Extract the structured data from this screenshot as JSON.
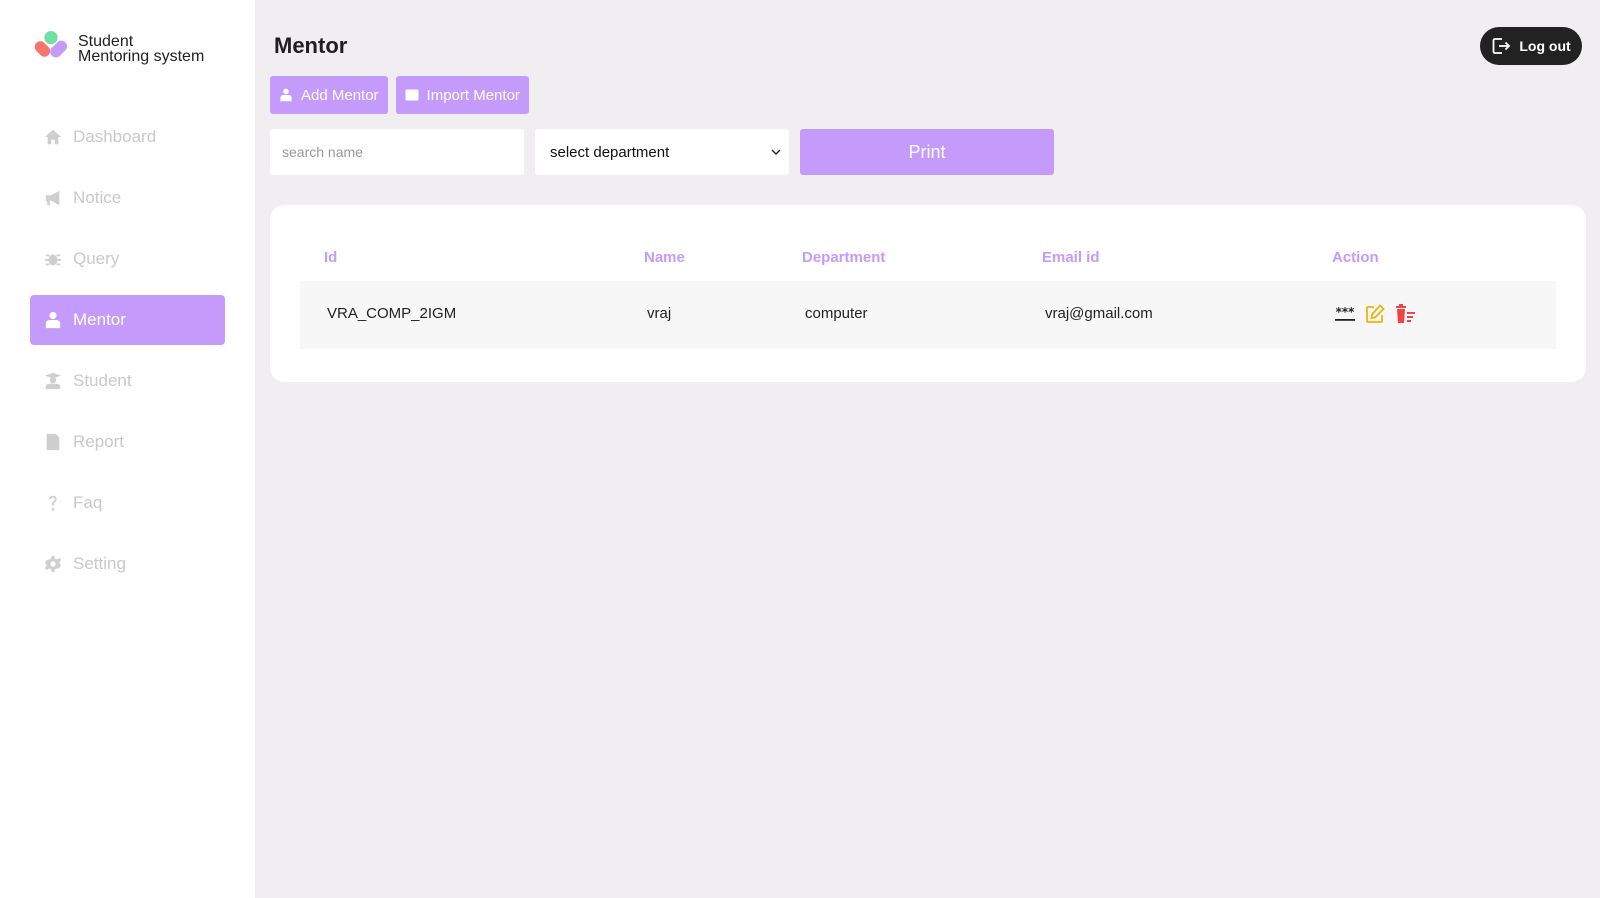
{
  "app": {
    "name_line1": "Student",
    "name_line2": "Mentoring system"
  },
  "sidebar": {
    "items": [
      {
        "label": "Dashboard",
        "icon": "home-icon"
      },
      {
        "label": "Notice",
        "icon": "megaphone-icon"
      },
      {
        "label": "Query",
        "icon": "bug-icon"
      },
      {
        "label": "Mentor",
        "icon": "mentor-icon",
        "active": true
      },
      {
        "label": "Student",
        "icon": "graduate-icon"
      },
      {
        "label": "Report",
        "icon": "report-icon"
      },
      {
        "label": "Faq",
        "icon": "question-icon"
      },
      {
        "label": "Setting",
        "icon": "gear-icon"
      }
    ]
  },
  "header": {
    "title": "Mentor",
    "logout_label": "Log out"
  },
  "toolbar": {
    "add_label": "Add Mentor",
    "import_label": "Import Mentor"
  },
  "filters": {
    "search_placeholder": "search name",
    "department_value": "select department",
    "print_label": "Print"
  },
  "table": {
    "columns": [
      "Id",
      "Name",
      "Department",
      "Email id",
      "Action"
    ],
    "rows": [
      {
        "id": "VRA_COMP_2IGM",
        "name": "vraj",
        "department": "computer",
        "email": "vraj@gmail.com"
      }
    ]
  },
  "colors": {
    "accent": "#c49bfb",
    "edit": "#f0b400",
    "delete": "#f04444"
  }
}
